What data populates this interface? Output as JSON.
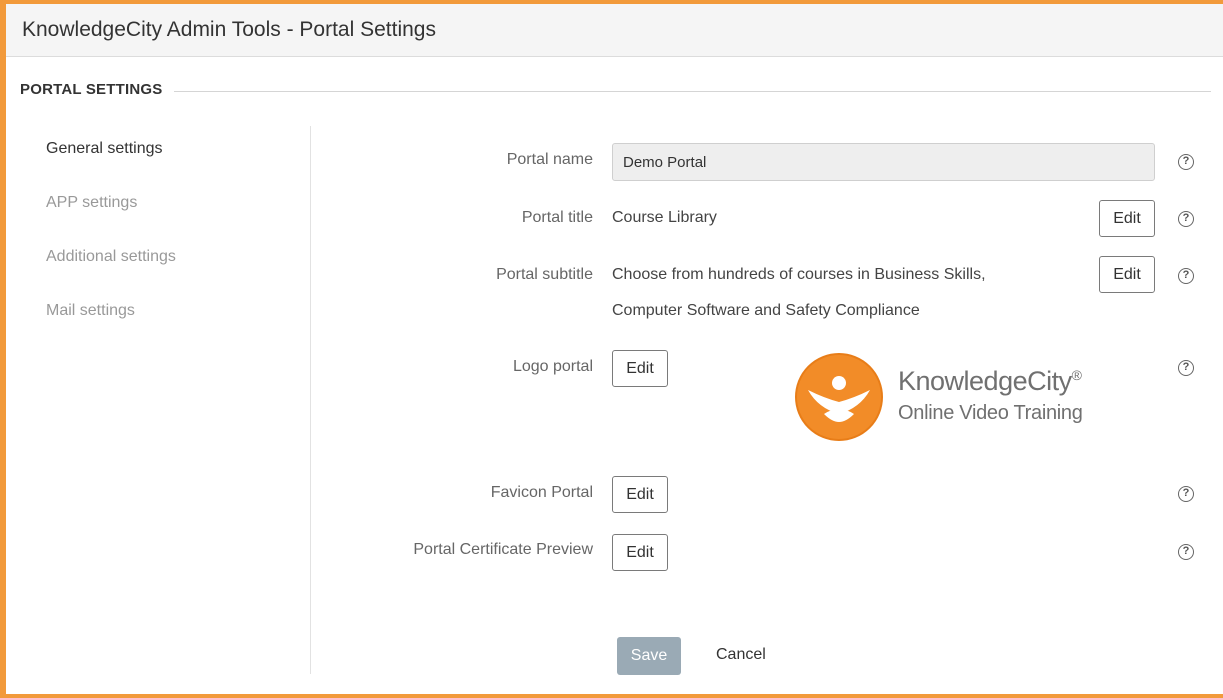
{
  "window": {
    "title": "KnowledgeCity Admin Tools - Portal Settings"
  },
  "section": {
    "title": "PORTAL SETTINGS"
  },
  "sidebar": {
    "items": [
      {
        "label": "General settings",
        "active": true
      },
      {
        "label": "APP settings",
        "active": false
      },
      {
        "label": "Additional settings",
        "active": false
      },
      {
        "label": "Mail settings",
        "active": false
      }
    ]
  },
  "form": {
    "portal_name": {
      "label": "Portal name",
      "value": "Demo Portal"
    },
    "portal_title": {
      "label": "Portal title",
      "value": "Course Library",
      "edit": "Edit"
    },
    "portal_subtitle": {
      "label": "Portal subtitle",
      "line1": "Choose from hundreds of courses in Business Skills,",
      "line2": "Computer Software and Safety Compliance",
      "edit": "Edit"
    },
    "logo_portal": {
      "label": "Logo portal",
      "edit": "Edit"
    },
    "favicon_portal": {
      "label": "Favicon Portal",
      "edit": "Edit"
    },
    "certificate_preview": {
      "label": "Portal Certificate Preview",
      "edit": "Edit"
    },
    "help_glyph": "?"
  },
  "logo": {
    "brand": "KnowledgeCity",
    "reg": "®",
    "tagline": "Online Video Training",
    "color": "#f28c28"
  },
  "actions": {
    "save": "Save",
    "cancel": "Cancel"
  },
  "colors": {
    "accent_border": "#f29a3b",
    "save_button": "#9aaab5"
  }
}
